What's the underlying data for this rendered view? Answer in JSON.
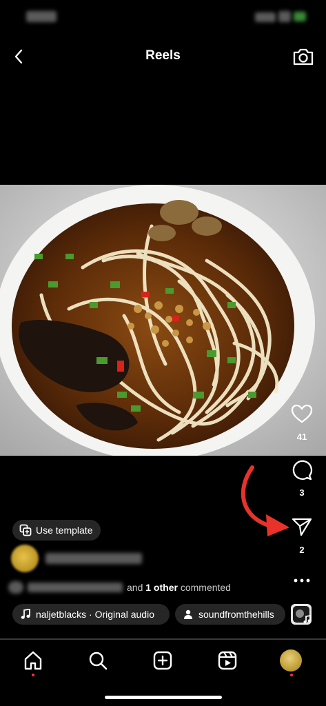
{
  "header": {
    "title": "Reels"
  },
  "icons": {
    "back": "chevron-left-icon",
    "camera": "camera-icon",
    "like": "heart-icon",
    "comment": "comment-bubble-icon",
    "share": "paper-plane-icon",
    "more": "more-dots-icon",
    "home": "home-icon",
    "search": "search-icon",
    "create": "plus-square-icon",
    "reels": "reels-icon"
  },
  "actions": {
    "likes_count": "41",
    "comments_count": "3",
    "shares_count": "2"
  },
  "template": {
    "label": "Use template"
  },
  "comment_summary": {
    "and_text": "and",
    "bold_text": "1 other",
    "suffix": "commented"
  },
  "audio": {
    "track_label": "naljetblacks · Original audio",
    "tagged_user": "soundfromthehills"
  },
  "colors": {
    "annotation_arrow": "#e8322a",
    "notification_dot": "#ff3040",
    "chip_background": "#262626"
  }
}
